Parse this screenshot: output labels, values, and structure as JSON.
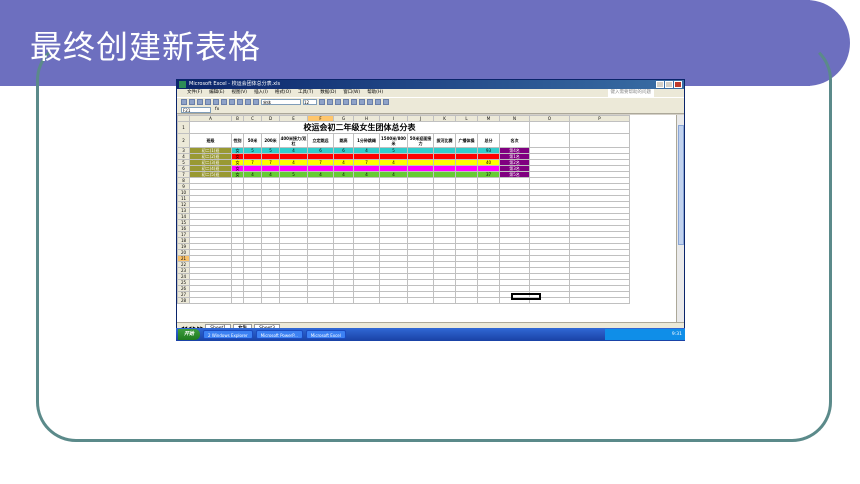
{
  "slide": {
    "title": "最终创建新表格"
  },
  "excel": {
    "window_title": "Microsoft Excel - 校运会团体总分表.xls",
    "menu": [
      "文件(F)",
      "编辑(E)",
      "视图(V)",
      "插入(I)",
      "格式(O)",
      "工具(T)",
      "数据(D)",
      "窗口(W)",
      "帮助(H)"
    ],
    "search_placeholder": "键入需要帮助的问题",
    "font_name": "宋体",
    "font_size": "12",
    "name_box": "F21",
    "fx_label": "fx",
    "columns": [
      "A",
      "B",
      "C",
      "D",
      "E",
      "F",
      "G",
      "H",
      "I",
      "J",
      "K",
      "L",
      "M",
      "N",
      "O",
      "P"
    ],
    "sheet_title": "校运会初二年级女生团体总分表",
    "headers": [
      "班级",
      "性别",
      "50米",
      "200米",
      "400米接力/双杠",
      "立定跳远",
      "跳高",
      "1分钟跳绳",
      "1500米/800米",
      "50米迎面接力",
      "拔河比赛",
      "广播体操",
      "总分",
      "名次"
    ],
    "rows": [
      {
        "num": "3",
        "cls": "初二(1)班",
        "sex": "女",
        "v": [
          "5",
          "5",
          "4",
          "6",
          "6",
          "4",
          "5",
          "",
          "",
          "",
          "93",
          "第4名"
        ],
        "color": "teal"
      },
      {
        "num": "4",
        "cls": "初二(2)班",
        "sex": "女",
        "v": [
          "",
          "",
          "",
          "",
          "",
          "",
          "",
          "",
          "",
          "",
          "",
          "第1名"
        ],
        "color": "red"
      },
      {
        "num": "5",
        "cls": "初二(3)班",
        "sex": "女",
        "v": [
          "7",
          "7",
          "4",
          "7",
          "4",
          "7",
          "4",
          "",
          "",
          "",
          "40",
          "第2名"
        ],
        "color": "yellow"
      },
      {
        "num": "6",
        "cls": "初二(4)班",
        "sex": "女",
        "v": [
          "",
          "",
          "",
          "",
          "",
          "",
          "",
          "",
          "",
          "",
          "",
          "第3名"
        ],
        "color": "magenta"
      },
      {
        "num": "7",
        "cls": "初二(5)班",
        "sex": "女",
        "v": [
          "4",
          "4",
          "5",
          "4",
          "4",
          "4",
          "4",
          "",
          "",
          "",
          "37",
          "第5名"
        ],
        "color": "green"
      }
    ],
    "empty_rows": [
      "8",
      "9",
      "10",
      "11",
      "12",
      "13",
      "14",
      "15",
      "16",
      "17",
      "18",
      "19",
      "20",
      "21",
      "22",
      "23",
      "24",
      "25",
      "26",
      "27",
      "28"
    ],
    "sheet_tabs": [
      "Sheet1",
      "女生",
      "Sheet3"
    ],
    "status": "就绪",
    "status_right": "数字"
  },
  "taskbar": {
    "start": "开始",
    "tasks": [
      "2 Windows Explorer",
      "Microsoft PowerP...",
      "Microsoft Excel"
    ],
    "clock": "9:31"
  },
  "colors": {
    "title_bar": "#6d6fbf",
    "frame": "#5b8a8a"
  }
}
